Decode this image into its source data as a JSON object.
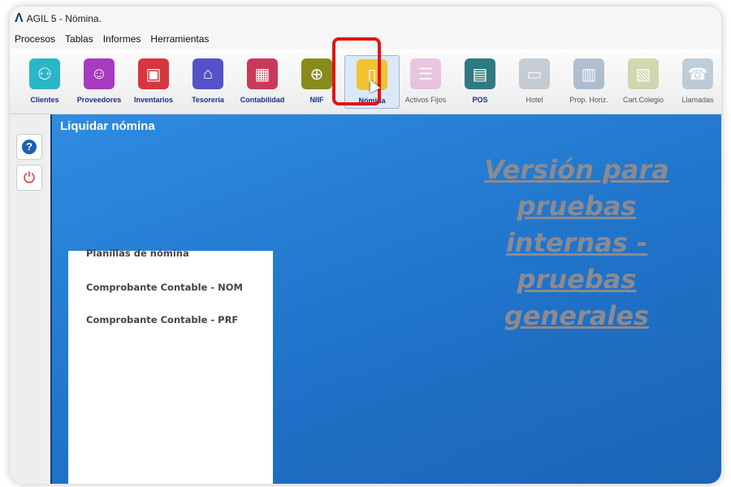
{
  "window": {
    "title": "AGIL 5 - Nómina."
  },
  "menu": [
    "Procesos",
    "Tablas",
    "Informes",
    "Herramientas"
  ],
  "toolbar": [
    {
      "label": "Clientes",
      "icon": "people-icon",
      "color": "#2bb6c7",
      "glyph": "⚇",
      "enabled": true
    },
    {
      "label": "Proveedores",
      "icon": "provider-icon",
      "color": "#a63bbf",
      "glyph": "☺",
      "enabled": true
    },
    {
      "label": "Inventarios",
      "icon": "box-icon",
      "color": "#d6363d",
      "glyph": "▣",
      "enabled": true
    },
    {
      "label": "Tesorería",
      "icon": "bank-icon",
      "color": "#5452c8",
      "glyph": "⌂",
      "enabled": true
    },
    {
      "label": "Contabilidad",
      "icon": "calculator-icon",
      "color": "#c93a5a",
      "glyph": "▦",
      "enabled": true
    },
    {
      "label": "NIIF",
      "icon": "globe-icon",
      "color": "#8a8a1a",
      "glyph": "⊕",
      "enabled": true
    },
    {
      "label": "Nómina",
      "icon": "payroll-icon",
      "color": "#f2c230",
      "glyph": "▯",
      "enabled": true,
      "selected": true
    },
    {
      "label": "Activos Fijos",
      "icon": "assets-icon",
      "color": "#d889c7",
      "glyph": "☰",
      "enabled": false
    },
    {
      "label": "POS",
      "icon": "store-icon",
      "color": "#2f7a82",
      "glyph": "▤",
      "enabled": true
    },
    {
      "label": "Hotel",
      "icon": "bed-icon",
      "color": "#8c9aa8",
      "glyph": "▭",
      "enabled": false
    },
    {
      "label": "Prop. Horiz.",
      "icon": "building-icon",
      "color": "#5c7ca3",
      "glyph": "▥",
      "enabled": false
    },
    {
      "label": "Cart.Colegio",
      "icon": "school-icon",
      "color": "#a2b45a",
      "glyph": "▧",
      "enabled": false
    },
    {
      "label": "Llamadas",
      "icon": "phone-icon",
      "color": "#7c9bb8",
      "glyph": "☎",
      "enabled": false
    }
  ],
  "main": {
    "title": "Liquidar nómina",
    "list": [
      "Planillas de nómina",
      "Comprobante Contable - NOM",
      "Comprobante Contable - PRF"
    ],
    "watermark": [
      "Versión para",
      "pruebas",
      "internas -",
      "pruebas",
      "generales"
    ]
  },
  "sidebar": {
    "help_glyph": "?",
    "power_glyph": "⏻"
  }
}
